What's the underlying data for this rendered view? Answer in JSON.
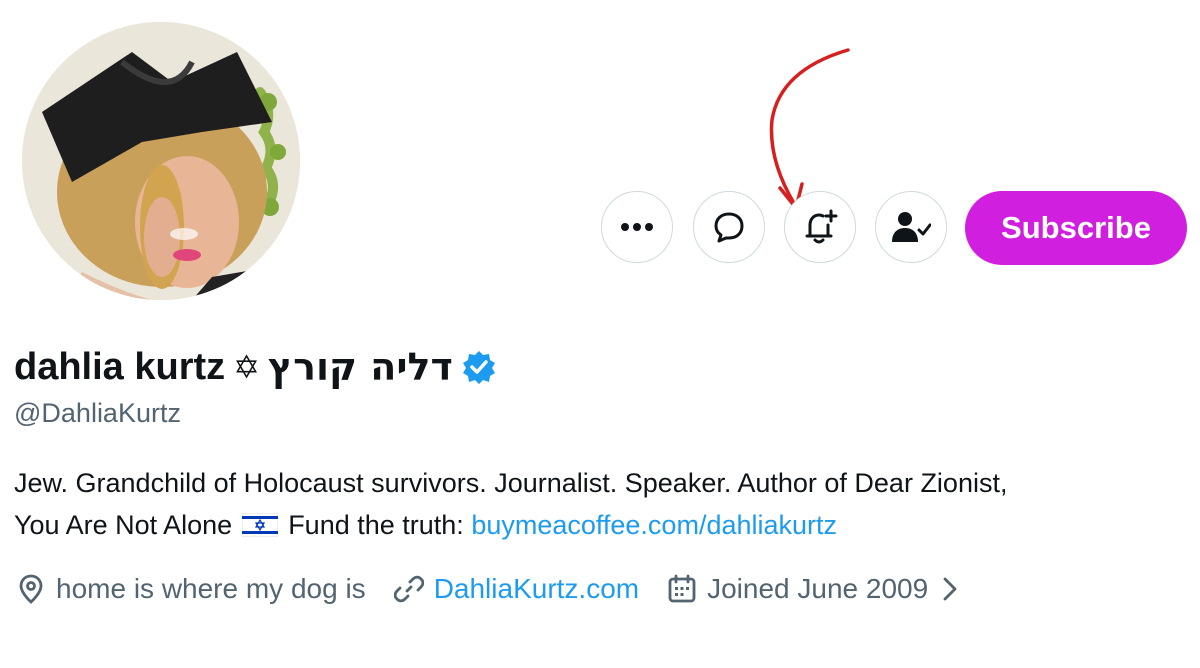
{
  "profile": {
    "display_name": "dahlia kurtz",
    "star_symbol": "✡",
    "hebrew_name": "דליה קורץ",
    "handle": "@DahliaKurtz",
    "verified_icon": "verified-badge-icon"
  },
  "actions": {
    "more_icon": "more-icon",
    "message_icon": "message-icon",
    "notify_icon": "bell-plus-icon",
    "following_icon": "person-check-icon",
    "subscribe_label": "Subscribe"
  },
  "bio": {
    "line1": "Jew. Grandchild of Holocaust survivors. Journalist. Speaker. Author of Dear Zionist,",
    "line2_text": "You Are Not Alone",
    "flag_icon": "israel-flag-icon",
    "line2_suffix": "Fund the truth:",
    "link": "buymeacoffee.com/dahliakurtz"
  },
  "meta": {
    "location": "home is where my dog is",
    "website": "DahliaKurtz.com",
    "joined": "Joined June 2009"
  },
  "colors": {
    "accent_link": "#1d9bf0",
    "subscribe_bg": "#d11fe0",
    "secondary_text": "#536471",
    "annotation_arrow": "#d62020"
  }
}
